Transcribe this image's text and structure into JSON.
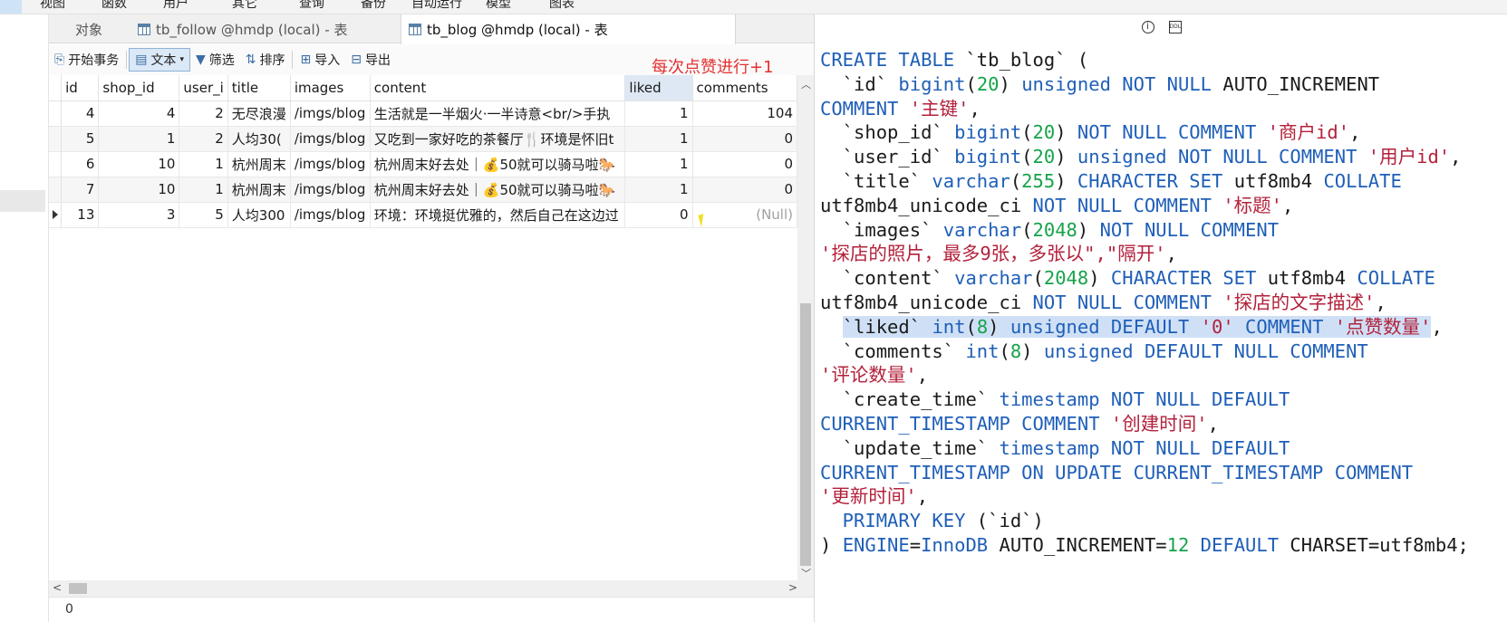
{
  "menu": [
    "视图",
    "函数",
    "用户",
    "其它",
    "查询",
    "备份",
    "自动运行",
    "模型",
    "图表"
  ],
  "tabs": {
    "object": "对象",
    "follow": "tb_follow @hmdp (local) - 表",
    "blog": "tb_blog @hmdp (local) - 表"
  },
  "toolbar": {
    "begin_tx": "开始事务",
    "text": "文本",
    "filter": "筛选",
    "sort": "排序",
    "import": "导入",
    "export": "导出"
  },
  "annotation": "每次点赞进行+1",
  "grid": {
    "columns": [
      "id",
      "shop_id",
      "user_i",
      "title",
      "images",
      "content",
      "liked",
      "comments"
    ],
    "rows": [
      {
        "id": "4",
        "shop_id": "4",
        "user_id": "2",
        "title": "无尽浪漫",
        "images": "/imgs/blog",
        "content": "生活就是一半烟火·一半诗意<br/>手执",
        "liked": "1",
        "comments": "104"
      },
      {
        "id": "5",
        "shop_id": "1",
        "user_id": "2",
        "title": "人均30(",
        "images": "/imgs/blog",
        "content": "又吃到一家好吃的茶餐厅🍴环境是怀旧t",
        "liked": "1",
        "comments": "0"
      },
      {
        "id": "6",
        "shop_id": "10",
        "user_id": "1",
        "title": "杭州周末",
        "images": "/imgs/blog",
        "content": "杭州周末好去处｜💰50就可以骑马啦🐎",
        "liked": "1",
        "comments": "0"
      },
      {
        "id": "7",
        "shop_id": "10",
        "user_id": "1",
        "title": "杭州周末",
        "images": "/imgs/blog",
        "content": "杭州周末好去处｜💰50就可以骑马啦🐎",
        "liked": "1",
        "comments": "0"
      },
      {
        "id": "13",
        "shop_id": "3",
        "user_id": "5",
        "title": "人均300",
        "images": "/imgs/blog",
        "content": "环境：环境挺优雅的，然后自己在这边过",
        "liked": "0",
        "comments": "(Null)"
      }
    ],
    "status": "0"
  },
  "ddl": {
    "lines": [
      [
        [
          "kw",
          "CREATE TABLE "
        ],
        [
          "t",
          "`tb_blog` ("
        ]
      ],
      [
        [
          "t",
          "  `id` "
        ],
        [
          "kw",
          "bigint"
        ],
        [
          "t",
          "("
        ],
        [
          "n",
          "20"
        ],
        [
          "t",
          ") "
        ],
        [
          "kw",
          "unsigned NOT NULL "
        ],
        [
          "t",
          "AUTO_INCREMENT"
        ]
      ],
      [
        [
          "kw",
          "COMMENT "
        ],
        [
          "s",
          "'主键'"
        ],
        [
          "t",
          ","
        ]
      ],
      [
        [
          "t",
          "  `shop_id` "
        ],
        [
          "kw",
          "bigint"
        ],
        [
          "t",
          "("
        ],
        [
          "n",
          "20"
        ],
        [
          "t",
          ") "
        ],
        [
          "kw",
          "NOT NULL COMMENT "
        ],
        [
          "s",
          "'商户id'"
        ],
        [
          "t",
          ","
        ]
      ],
      [
        [
          "t",
          "  `user_id` "
        ],
        [
          "kw",
          "bigint"
        ],
        [
          "t",
          "("
        ],
        [
          "n",
          "20"
        ],
        [
          "t",
          ") "
        ],
        [
          "kw",
          "unsigned NOT NULL COMMENT "
        ],
        [
          "s",
          "'用户id'"
        ],
        [
          "t",
          ","
        ]
      ],
      [
        [
          "t",
          "  `title` "
        ],
        [
          "kw",
          "varchar"
        ],
        [
          "t",
          "("
        ],
        [
          "n",
          "255"
        ],
        [
          "t",
          ") "
        ],
        [
          "kw",
          "CHARACTER SET "
        ],
        [
          "t",
          "utf8mb4 "
        ],
        [
          "kw",
          "COLLATE"
        ]
      ],
      [
        [
          "t",
          "utf8mb4_unicode_ci "
        ],
        [
          "kw",
          "NOT NULL COMMENT "
        ],
        [
          "s",
          "'标题'"
        ],
        [
          "t",
          ","
        ]
      ],
      [
        [
          "t",
          "  `images` "
        ],
        [
          "kw",
          "varchar"
        ],
        [
          "t",
          "("
        ],
        [
          "n",
          "2048"
        ],
        [
          "t",
          ") "
        ],
        [
          "kw",
          "NOT NULL COMMENT"
        ]
      ],
      [
        [
          "s",
          "'探店的照片，最多9张，多张以\",\"隔开'"
        ],
        [
          "t",
          ","
        ]
      ],
      [
        [
          "t",
          "  `content` "
        ],
        [
          "kw",
          "varchar"
        ],
        [
          "t",
          "("
        ],
        [
          "n",
          "2048"
        ],
        [
          "t",
          ") "
        ],
        [
          "kw",
          "CHARACTER SET "
        ],
        [
          "t",
          "utf8mb4 "
        ],
        [
          "kw",
          "COLLATE"
        ]
      ],
      [
        [
          "t",
          "utf8mb4_unicode_ci "
        ],
        [
          "kw",
          "NOT NULL COMMENT "
        ],
        [
          "s",
          "'探店的文字描述'"
        ],
        [
          "t",
          ","
        ]
      ],
      [
        [
          "t",
          "  "
        ],
        [
          "hi_t",
          "`liked` "
        ],
        [
          "hi_kw",
          "int"
        ],
        [
          "hi_t",
          "("
        ],
        [
          "hi_n",
          "8"
        ],
        [
          "hi_t",
          ") "
        ],
        [
          "hi_kw",
          "unsigned DEFAULT "
        ],
        [
          "hi_s",
          "'0'"
        ],
        [
          "hi_kw",
          " COMMENT "
        ],
        [
          "hi_s",
          "'点赞数量'"
        ],
        [
          "t",
          ","
        ]
      ],
      [
        [
          "t",
          "  `comments` "
        ],
        [
          "kw",
          "int"
        ],
        [
          "t",
          "("
        ],
        [
          "n",
          "8"
        ],
        [
          "t",
          ") "
        ],
        [
          "kw",
          "unsigned DEFAULT NULL COMMENT"
        ]
      ],
      [
        [
          "s",
          "'评论数量'"
        ],
        [
          "t",
          ","
        ]
      ],
      [
        [
          "t",
          "  `create_time` "
        ],
        [
          "kw",
          "timestamp NOT NULL DEFAULT"
        ]
      ],
      [
        [
          "kw",
          "CURRENT_TIMESTAMP COMMENT "
        ],
        [
          "s",
          "'创建时间'"
        ],
        [
          "t",
          ","
        ]
      ],
      [
        [
          "t",
          "  `update_time` "
        ],
        [
          "kw",
          "timestamp NOT NULL DEFAULT"
        ]
      ],
      [
        [
          "kw",
          "CURRENT_TIMESTAMP ON UPDATE CURRENT_TIMESTAMP COMMENT"
        ]
      ],
      [
        [
          "s",
          "'更新时间'"
        ],
        [
          "t",
          ","
        ]
      ],
      [
        [
          "kw",
          "  PRIMARY KEY "
        ],
        [
          "t",
          "(`id`)"
        ]
      ],
      [
        [
          "t",
          ") "
        ],
        [
          "kw",
          "ENGINE"
        ],
        [
          "t",
          "="
        ],
        [
          "kw",
          "InnoDB "
        ],
        [
          "t",
          "AUTO_INCREMENT="
        ],
        [
          "n",
          "12"
        ],
        [
          "kw",
          " DEFAULT "
        ],
        [
          "t",
          "CHARSET=utf8mb4;"
        ]
      ]
    ]
  }
}
